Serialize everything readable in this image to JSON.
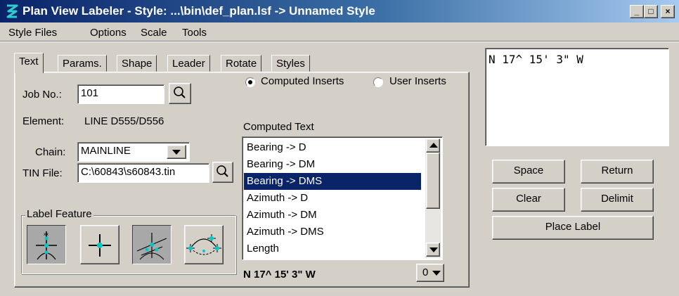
{
  "window": {
    "title": "Plan View Labeler - Style: ...\\bin\\def_plan.lsf -> Unnamed Style",
    "buttons": {
      "minimize": "_",
      "maximize": "□",
      "close": "×"
    }
  },
  "menu": [
    {
      "label": "Style Files"
    },
    {
      "label": "Options"
    },
    {
      "label": "Scale"
    },
    {
      "label": "Tools"
    }
  ],
  "tabs": [
    {
      "label": "Text"
    },
    {
      "label": "Params."
    },
    {
      "label": "Shape"
    },
    {
      "label": "Leader"
    },
    {
      "label": "Rotate"
    },
    {
      "label": "Styles"
    }
  ],
  "text_tab": {
    "job_label": "Job No.:",
    "job_value": "101",
    "element_label": "Element:",
    "element_value": "LINE D555/D556",
    "chain_label": "Chain:",
    "chain_value": "MAINLINE",
    "tin_label": "TIN File:",
    "tin_value": "C:\\60843\\s60843.tin",
    "radio_computed": "Computed Inserts",
    "radio_user": "User Inserts",
    "computed_text_label": "Computed Text",
    "computed_items": [
      "Bearing -> D",
      "Bearing -> DM",
      "Bearing -> DMS",
      "Azimuth -> D",
      "Azimuth -> DM",
      "Azimuth -> DMS",
      "Length"
    ],
    "selected_index": 2,
    "preview_value": "N 17^ 15' 3\" W",
    "precision_value": "0",
    "label_feature_title": "Label Feature"
  },
  "preview_text": "N 17^ 15' 3\" W",
  "buttons": {
    "space": "Space",
    "return": "Return",
    "clear": "Clear",
    "delimit": "Delimit",
    "place_label": "Place Label"
  },
  "colors": {
    "face": "#d4d0c8",
    "title_start": "#0a246a",
    "title_end": "#a6caf0",
    "selection": "#0a246a",
    "feature_point": "#00c8c8"
  }
}
